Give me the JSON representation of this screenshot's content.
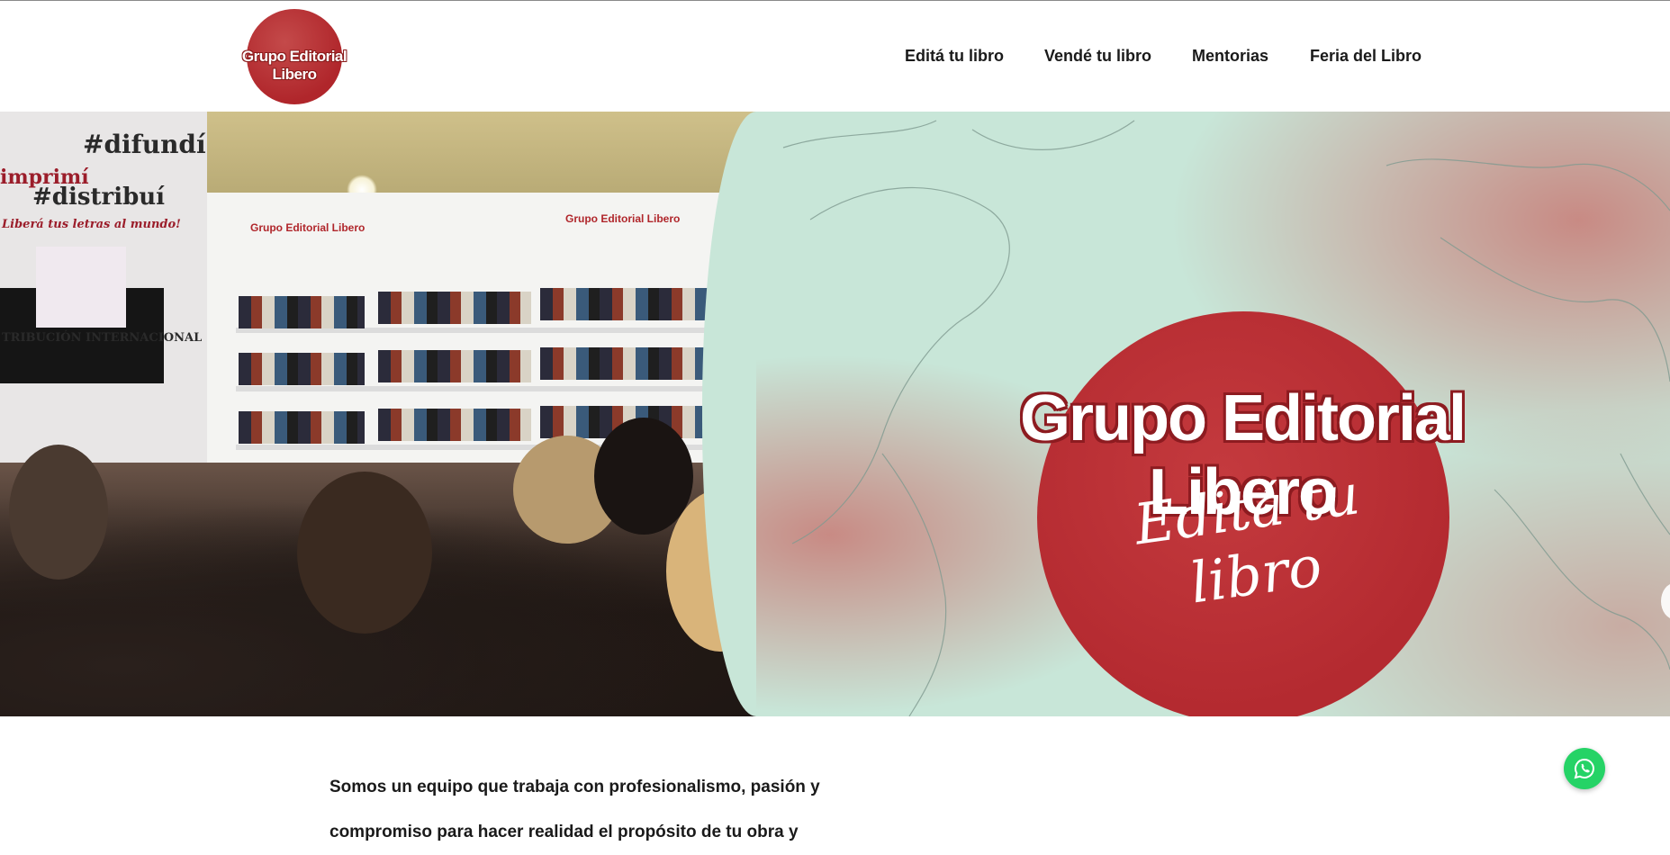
{
  "brand": {
    "logo_text": "Grupo Editorial Libero"
  },
  "nav": {
    "items": [
      {
        "label": "Editá tu libro"
      },
      {
        "label": "Vendé tu libro"
      },
      {
        "label": "Mentorias"
      },
      {
        "label": "Feria del Libro"
      }
    ]
  },
  "hero": {
    "title": "Grupo Editorial Libero",
    "tagline": "Editá tu libro",
    "photo_texts": {
      "hashtag_1": "#difundí",
      "hashtag_2": "imprimí",
      "hashtag_3": "#distribuí",
      "slogan": "Liberá tus letras al mundo!",
      "distribution": "TRIBUCIÓN INTERNACIONAL",
      "booth_label": "Grupo Editorial Libero"
    }
  },
  "content": {
    "intro_line_1": "Somos un equipo que trabaja con profesionalismo, pasión y",
    "intro_line_2": "compromiso para hacer realidad el propósito de tu obra y"
  },
  "colors": {
    "brand_red": "#b42a30",
    "mint_bg": "#c8e6d8",
    "whatsapp_green": "#25d366"
  },
  "icons": {
    "whatsapp": "whatsapp-icon",
    "next": "chevron-right-icon"
  }
}
